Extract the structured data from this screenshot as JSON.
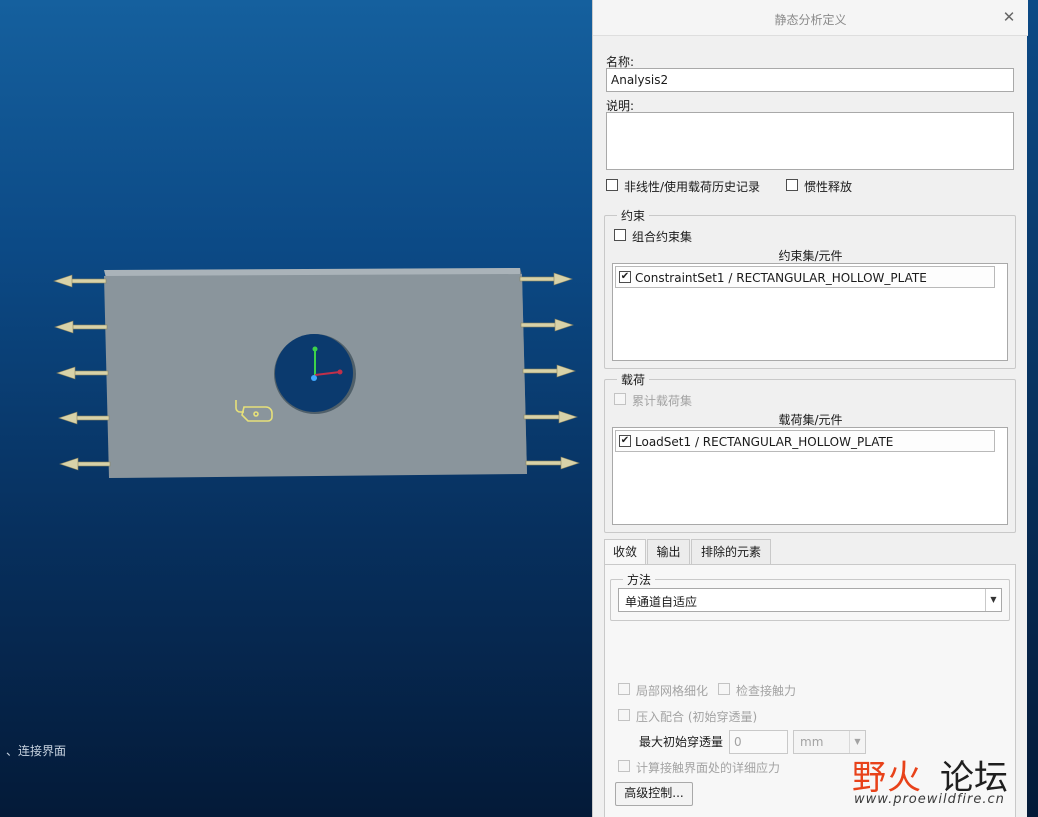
{
  "viewport": {
    "status_text": "、连接界面",
    "colors": {
      "plate": "#8a959c",
      "hole": "#0b3a6e",
      "arrow": "#d8d2a8",
      "tag": "#e6e07a"
    }
  },
  "dialog": {
    "title": "静态分析定义",
    "close_icon": "close-icon",
    "name_label": "名称:",
    "name_value": "Analysis2",
    "desc_label": "说明:",
    "desc_value": "",
    "nonlinear_label": "非线性/使用载荷历史记录",
    "nonlinear_checked": false,
    "inertia_label": "惯性释放",
    "inertia_checked": false,
    "constraints": {
      "legend": "约束",
      "combine_label": "组合约束集",
      "combine_checked": false,
      "list_header": "约束集/元件",
      "items": [
        {
          "text": "ConstraintSet1 / RECTANGULAR_HOLLOW_PLATE",
          "checked": true
        }
      ]
    },
    "loads": {
      "legend": "载荷",
      "cumulative_label": "累计载荷集",
      "cumulative_checked": false,
      "list_header": "载荷集/元件",
      "items": [
        {
          "text": "LoadSet1 / RECTANGULAR_HOLLOW_PLATE",
          "checked": true
        }
      ]
    },
    "tabs": [
      {
        "label": "收敛",
        "active": true
      },
      {
        "label": "输出",
        "active": false
      },
      {
        "label": "排除的元素",
        "active": false
      }
    ],
    "convergence": {
      "method_legend": "方法",
      "method_value": "单通道自适应",
      "local_mesh_label": "局部网格细化",
      "check_contact_label": "检查接触力",
      "press_fit_label": "压入配合 (初始穿透量)",
      "max_penetration_label": "最大初始穿透量",
      "max_penetration_value": "0",
      "unit_value": "mm",
      "detailed_stress_label": "计算接触界面处的详细应力",
      "advanced_button": "高级控制..."
    }
  },
  "watermark": {
    "brand_red": "野火",
    "brand_dark": "论坛",
    "url": "www.proewildfire.cn"
  }
}
